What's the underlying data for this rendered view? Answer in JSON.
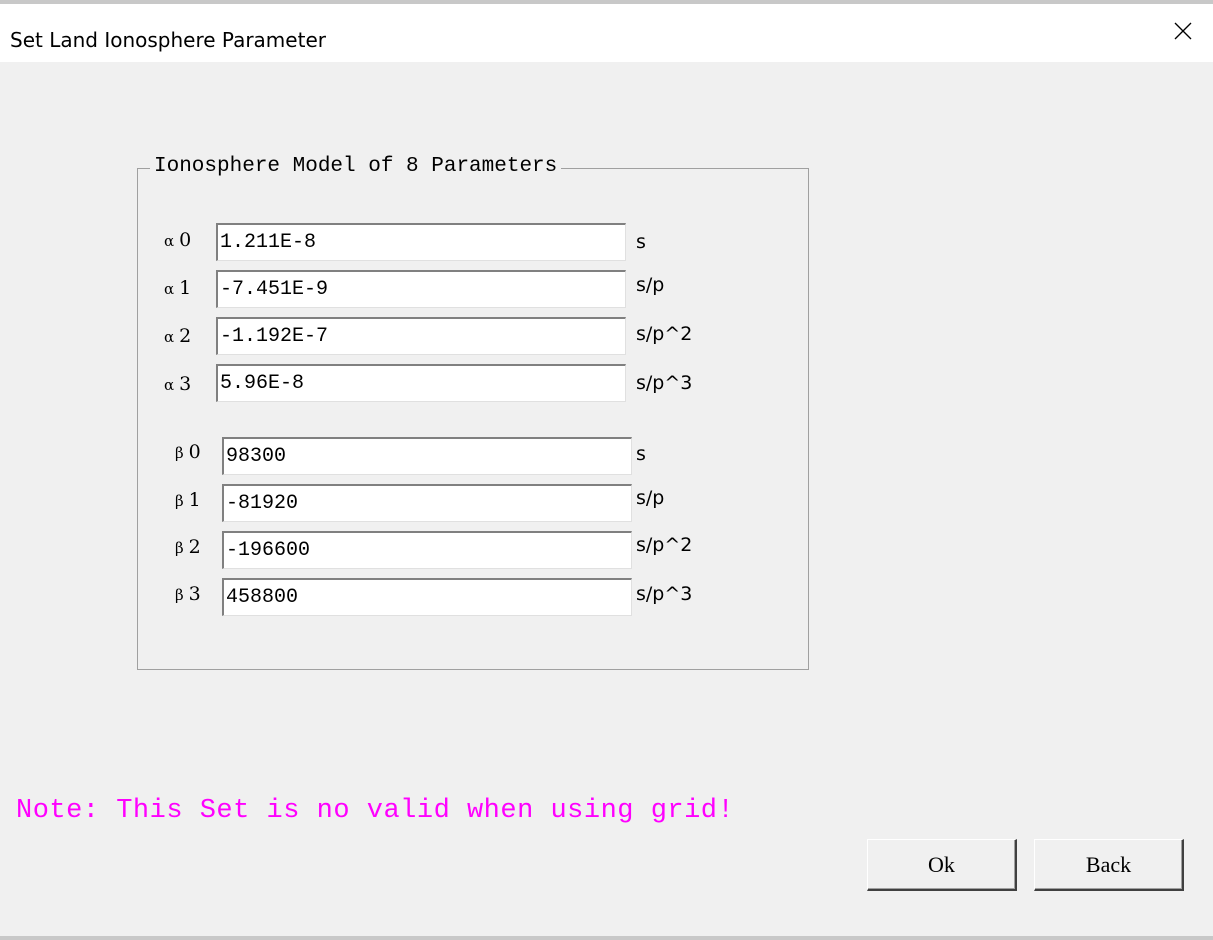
{
  "window": {
    "title": "Set Land Ionosphere Parameter"
  },
  "group": {
    "legend": "Ionosphere Model of 8 Parameters"
  },
  "alpha": [
    {
      "symbol": "α",
      "index": "0",
      "value": "1.211E-8",
      "unit": "s"
    },
    {
      "symbol": "α",
      "index": "1",
      "value": "-7.451E-9",
      "unit": "s/p"
    },
    {
      "symbol": "α",
      "index": "2",
      "value": "-1.192E-7",
      "unit": "s/p^2"
    },
    {
      "symbol": "α",
      "index": "3",
      "value": "5.96E-8",
      "unit": "s/p^3"
    }
  ],
  "beta": [
    {
      "symbol": "β",
      "index": "0",
      "value": "98300",
      "unit": "s"
    },
    {
      "symbol": "β",
      "index": "1",
      "value": "-81920",
      "unit": "s/p"
    },
    {
      "symbol": "β",
      "index": "2",
      "value": "-196600",
      "unit": "s/p^2"
    },
    {
      "symbol": "β",
      "index": "3",
      "value": "458800",
      "unit": "s/p^3"
    }
  ],
  "note": "Note: This Set is no valid when using grid!",
  "buttons": {
    "ok": "Ok",
    "back": "Back"
  },
  "colors": {
    "note": "#ff00ff",
    "background": "#f0f0f0"
  },
  "icons": {
    "close": "close-icon"
  }
}
